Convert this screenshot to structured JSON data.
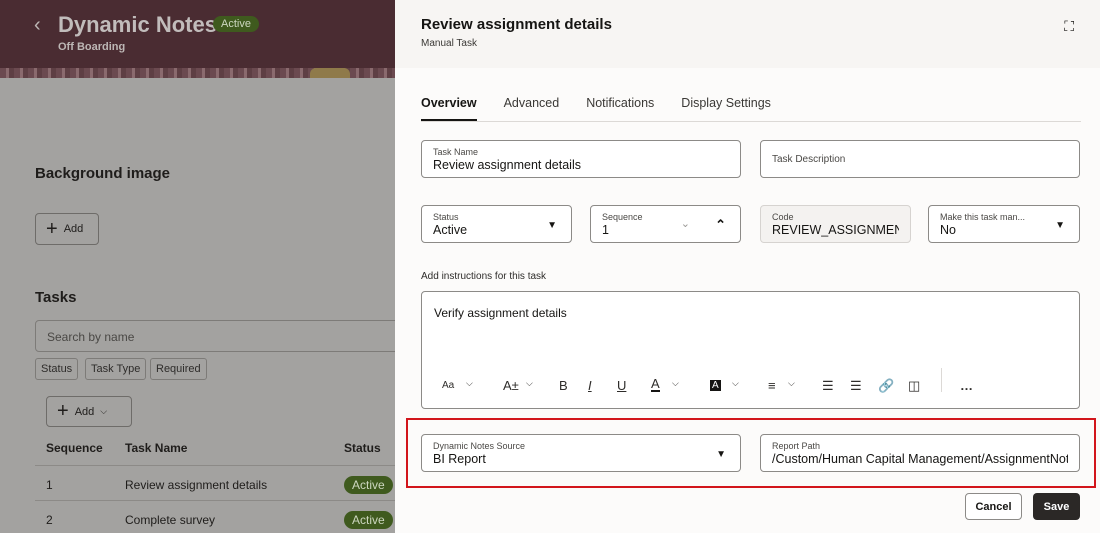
{
  "left": {
    "back_icon": "chevron-left",
    "title": "Dynamic Notes",
    "status": "Active",
    "subtitle": "Off Boarding",
    "background_heading": "Background image",
    "add_label": "Add",
    "tasks_heading": "Tasks",
    "search_placeholder": "Search by name",
    "filters": [
      "Status",
      "Task Type",
      "Required"
    ],
    "add_task_label": "Add",
    "columns": [
      "Sequence",
      "Task Name",
      "Status"
    ],
    "rows": [
      {
        "seq": "1",
        "name": "Review assignment details",
        "status": "Active"
      },
      {
        "seq": "2",
        "name": "Complete survey",
        "status": "Active"
      }
    ]
  },
  "panel": {
    "title": "Review assignment details",
    "subtitle": "Manual Task",
    "tabs": [
      "Overview",
      "Advanced",
      "Notifications",
      "Display Settings"
    ],
    "task_name_label": "Task Name",
    "task_name": "Review assignment details",
    "task_desc_label": "Task Description",
    "status_label": "Status",
    "status": "Active",
    "sequence_label": "Sequence",
    "sequence": "1",
    "code_label": "Code",
    "code": "REVIEW_ASSIGNMENT_",
    "mandatory_label": "Make this task man...",
    "mandatory": "No",
    "instructions_label": "Add instructions for this task",
    "instructions": "Verify assignment details",
    "toolbar": {
      "font": "Aa",
      "size": "A±",
      "bold": "B",
      "italic": "I",
      "underline": "U",
      "color": "A",
      "highlight": "A",
      "more": "…"
    },
    "source_label": "Dynamic Notes Source",
    "source": "BI Report",
    "report_path_label": "Report Path",
    "report_path": "/Custom/Human Capital Management/AssignmentNotes",
    "cancel": "Cancel",
    "save": "Save"
  },
  "colors": {
    "header": "#4a2c32",
    "active_pill": "#3f5a1e",
    "highlight_box": "#d2151b",
    "save": "#2b2826"
  }
}
